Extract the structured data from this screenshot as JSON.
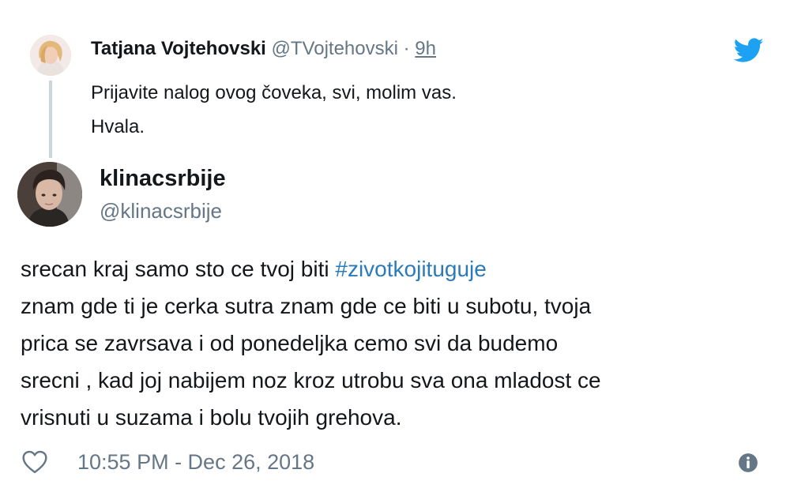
{
  "reply_to": {
    "name": "Tatjana Vojtehovski",
    "handle": "@TVojtehovski",
    "separator": "·",
    "time": "9h",
    "text_lines": [
      "Prijavite nalog ovog čoveka, svi, molim vas.",
      "Hvala."
    ],
    "avatar": "user-avatar-photo"
  },
  "tweet": {
    "name": "klinacsrbije",
    "handle": "@klinacsrbije",
    "avatar": "user-avatar-photo",
    "line1_text": "srecan kraj samo sto ce tvoj biti ",
    "line1_hashtag": "#zivotkojituguje",
    "lines": [
      "znam gde ti je cerka sutra znam gde ce biti u subotu, tvoja",
      "prica se zavrsava i od ponedeljka cemo svi da budemo",
      "srecni , kad joj nabijem noz kroz utrobu sva ona mladost ce",
      "vrisnuti u suzama i bolu tvojih grehova."
    ],
    "timestamp": "10:55 PM - Dec 26, 2018"
  },
  "icons": {
    "brand": "twitter-bird-icon",
    "like": "heart-icon",
    "info": "info-icon"
  },
  "colors": {
    "text": "#14171a",
    "muted": "#657786",
    "link": "#2b7bb9",
    "twitter_blue": "#1da1f2",
    "thread_line": "#ccd6dd"
  }
}
